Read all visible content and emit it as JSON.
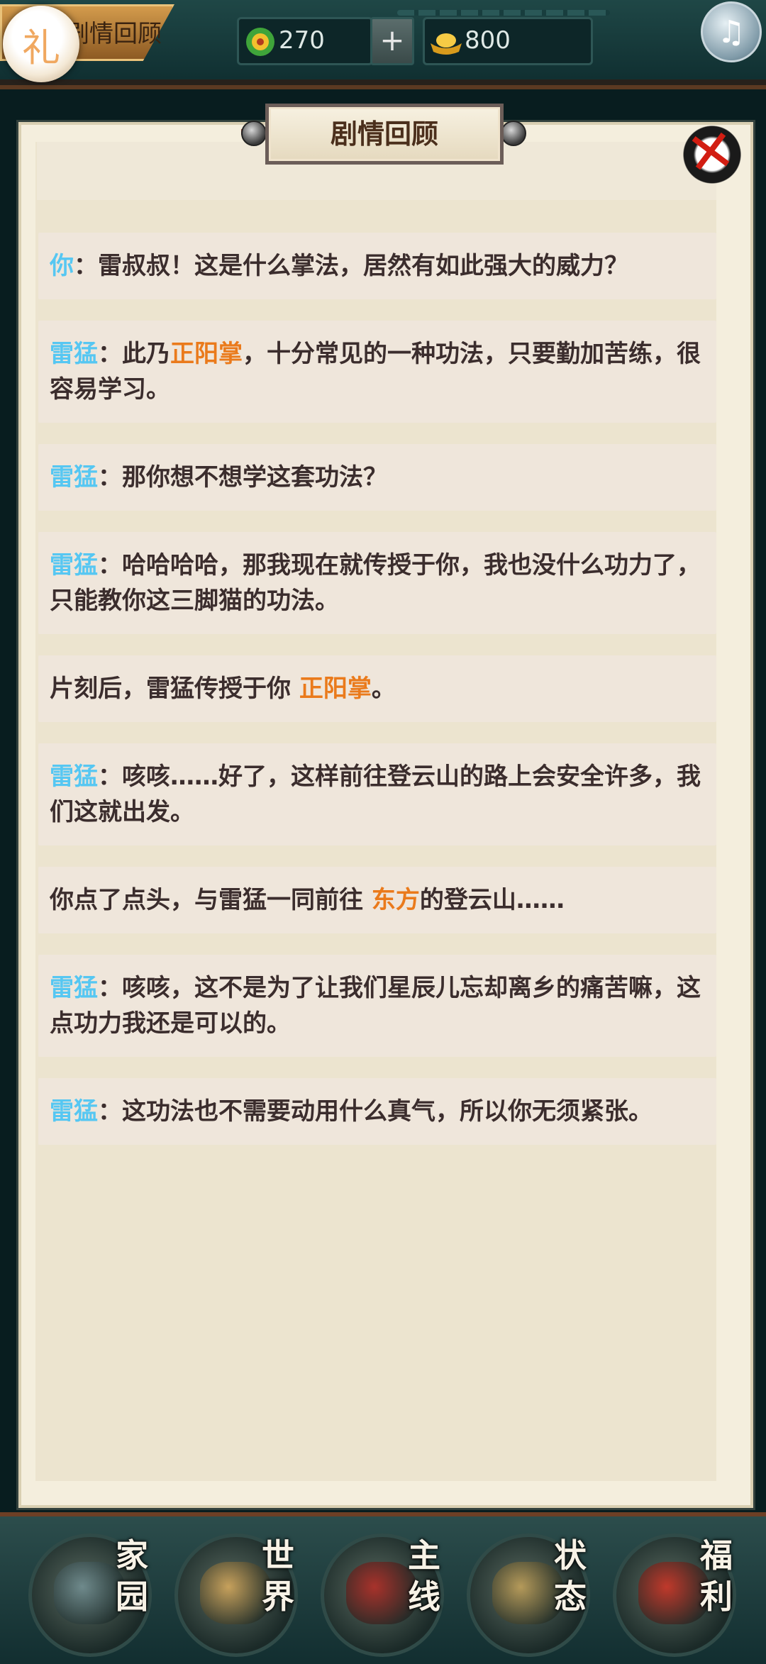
{
  "top_bar": {
    "title_tab": "剧情回顾",
    "gift_button": "礼",
    "jade": {
      "icon": "jade-orb-icon",
      "value": "270"
    },
    "plus_label": "+",
    "gold": {
      "icon": "gold-ingot-icon",
      "value": "800"
    },
    "music_icon": "music-note-icon"
  },
  "panel": {
    "title": "剧情回顾",
    "close_icon": "close-x-icon"
  },
  "dialogue": [
    {
      "speaker": "你",
      "parts": [
        "：雷叔叔！这是什么掌法，居然有如此强大的威力？"
      ]
    },
    {
      "speaker": "雷猛",
      "parts": [
        "：此乃",
        "正阳掌",
        "，十分常见的一种功法，只要勤加苦练，很容易学习。"
      ]
    },
    {
      "speaker": "雷猛",
      "parts": [
        "：那你想不想学这套功法？"
      ]
    },
    {
      "speaker": "雷猛",
      "parts": [
        "：哈哈哈哈，那我现在就传授于你，我也没什么功力了，只能教你这三脚猫的功法。"
      ]
    },
    {
      "speaker": "",
      "parts": [
        "片刻后，雷猛传授于你 ",
        "正阳掌",
        "。"
      ]
    },
    {
      "speaker": "雷猛",
      "parts": [
        "：咳咳……好了，这样前往登云山的路上会安全许多，我们这就出发。"
      ]
    },
    {
      "speaker": "",
      "parts": [
        "你点了点头，与雷猛一同前往 ",
        "东方",
        "的登云山……"
      ]
    },
    {
      "speaker": "雷猛",
      "parts": [
        "：咳咳，这不是为了让我们星辰儿忘却离乡的痛苦嘛，这点功力我还是可以的。"
      ]
    },
    {
      "speaker": "雷猛",
      "parts": [
        "：这功法也不需要动用什么真气，所以你无须紧张。"
      ]
    }
  ],
  "bottom_nav": [
    {
      "label": "家园",
      "icon": "homestead-icon",
      "color": "#6f8a8c"
    },
    {
      "label": "世界",
      "icon": "world-map-icon",
      "color": "#c7a15c"
    },
    {
      "label": "主线",
      "icon": "main-quest-icon",
      "color": "#a8322b"
    },
    {
      "label": "状态",
      "icon": "status-scroll-icon",
      "color": "#b59a5a"
    },
    {
      "label": "福利",
      "icon": "welfare-gift-icon",
      "color": "#c0392b"
    }
  ],
  "colors": {
    "speaker": "#56c7f2",
    "highlight": "#ea7a1b",
    "text": "#3b2d2d"
  }
}
